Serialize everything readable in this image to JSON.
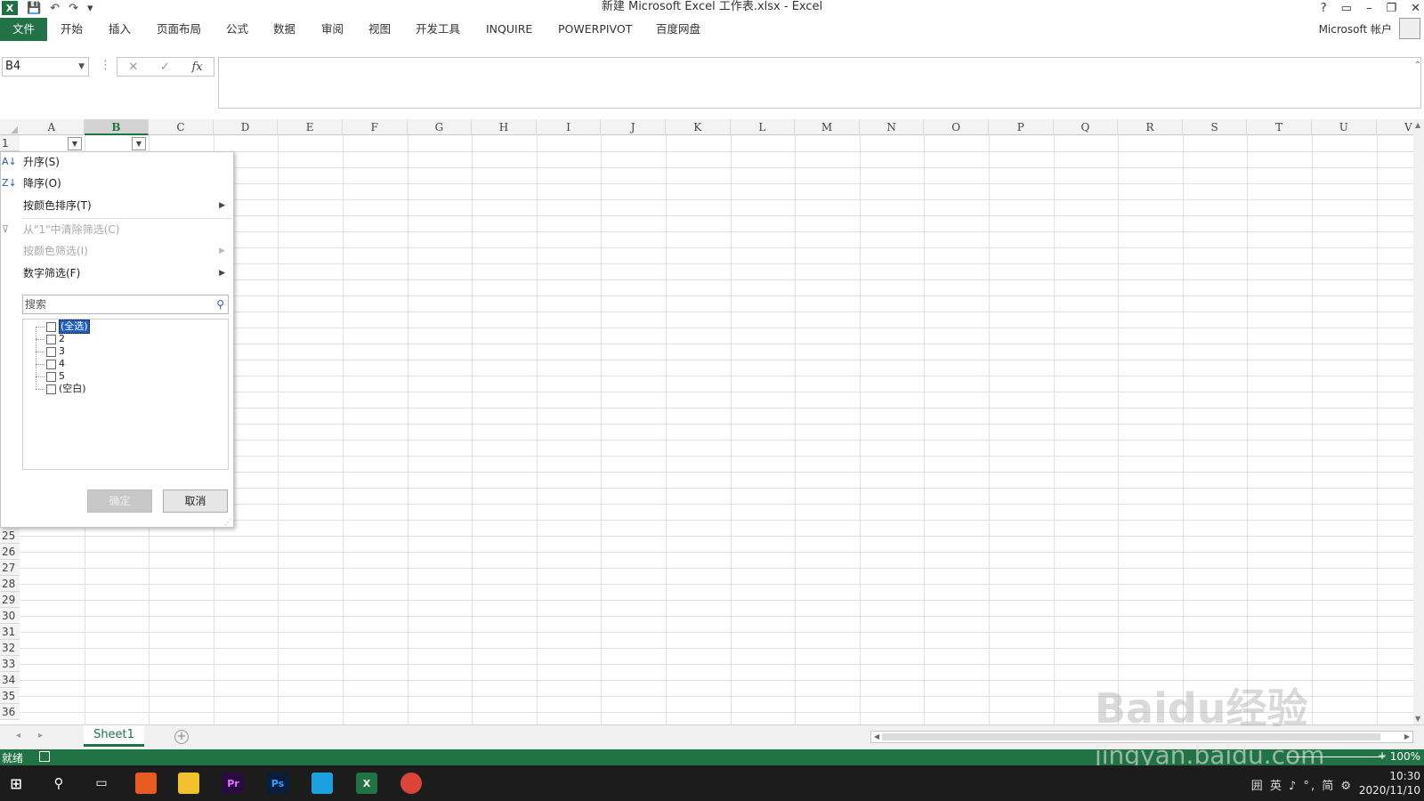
{
  "window": {
    "title": "新建 Microsoft Excel 工作表.xlsx - Excel",
    "controls": [
      "?",
      "▭",
      "–",
      "❐",
      "✕"
    ]
  },
  "ribbon": {
    "tabs": [
      "文件",
      "开始",
      "插入",
      "页面布局",
      "公式",
      "数据",
      "审阅",
      "视图",
      "开发工具",
      "INQUIRE",
      "POWERPIVOT",
      "百度网盘"
    ],
    "account": "Microsoft 帐户"
  },
  "formula_bar": {
    "name_box": "B4",
    "cancel_icon": "✕",
    "enter_icon": "✓",
    "fx_label": "fx",
    "formula_value": ""
  },
  "grid": {
    "columns": [
      "A",
      "B",
      "C",
      "D",
      "E",
      "F",
      "G",
      "H",
      "I",
      "J",
      "K",
      "L",
      "M",
      "N",
      "O",
      "P",
      "Q",
      "R",
      "S",
      "T",
      "U",
      "V"
    ],
    "selected_column": "B",
    "visible_rows_top": [
      "1"
    ],
    "visible_rows_bottom": [
      "25",
      "26",
      "27",
      "28",
      "29",
      "30",
      "31",
      "32",
      "33",
      "34",
      "35",
      "36"
    ]
  },
  "filter_menu": {
    "sort_asc": "升序(S)",
    "sort_desc": "降序(O)",
    "sort_by_color": "按颜色排序(T)",
    "clear_filter": "从\"1\"中清除筛选(C)",
    "filter_by_color": "按颜色筛选(I)",
    "number_filter": "数字筛选(F)",
    "search_placeholder": "搜索",
    "items": [
      {
        "label": "(全选)",
        "checked": false,
        "highlighted": true
      },
      {
        "label": "2",
        "checked": false,
        "highlighted": false
      },
      {
        "label": "3",
        "checked": false,
        "highlighted": false
      },
      {
        "label": "4",
        "checked": false,
        "highlighted": false
      },
      {
        "label": "5",
        "checked": false,
        "highlighted": false
      },
      {
        "label": "(空白)",
        "checked": false,
        "highlighted": false
      }
    ],
    "ok_label": "确定",
    "cancel_label": "取消"
  },
  "sheets": {
    "active": "Sheet1"
  },
  "status": {
    "text": "就绪",
    "zoom": "100%"
  },
  "taskbar": {
    "apps": [
      "Pr",
      "Ps",
      "X"
    ],
    "tray_text": "囲 英 ♪ °, 简 ⚙",
    "time": "10:30",
    "date": "2020/11/10"
  },
  "watermark": {
    "brand": "Baidu经验",
    "url": "jingyan.baidu.com"
  },
  "colors": {
    "excel_green": "#217346",
    "selection_blue": "#1f5fbf"
  }
}
